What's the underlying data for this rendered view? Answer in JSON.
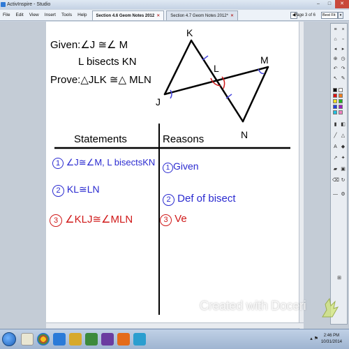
{
  "window": {
    "title": "ActivInspire - Studio",
    "min": "–",
    "max": "□",
    "close": "✕"
  },
  "menu": [
    "File",
    "Edit",
    "View",
    "Insert",
    "Tools",
    "Help"
  ],
  "tabs": [
    {
      "label": "Section 4.6 Geom Notes 2012",
      "close": "✕"
    },
    {
      "label": "Section 4.7 Geom Notes 2012*",
      "close": "✕"
    }
  ],
  "page_nav": {
    "prev": "◀",
    "page": "Page 3 of 6",
    "next": "▶",
    "zoom": "Best Fit",
    "dropdown": "▾"
  },
  "given": {
    "line1": "Given:∠J ≅∠ M",
    "line2": "L bisects KN",
    "line3": "Prove:△JLK ≅△ MLN"
  },
  "diagram_labels": {
    "K": "K",
    "L": "L",
    "M": "M",
    "J": "J",
    "N": "N"
  },
  "table": {
    "statements_header": "Statements",
    "reasons_header": "Reasons"
  },
  "proof": [
    {
      "num": "1",
      "statement": "∠J≅∠M, L bisectsKN",
      "reason_num": "1",
      "reason": "Given",
      "color": "#2a2ad0"
    },
    {
      "num": "2",
      "statement": "KL≅LN",
      "reason_num": "2",
      "reason": "Def of bisect",
      "color": "#2a2ad0"
    },
    {
      "num": "3",
      "statement": "∠KLJ≅∠MLN",
      "reason_num": "3",
      "reason": "Ve",
      "color": "#d01818"
    }
  ],
  "watermark": "Created with Doceri",
  "taskbar": {
    "time": "2:46 PM",
    "date": "10/31/2014"
  },
  "colors": {
    "ink_blue": "#2a2ad0",
    "ink_red": "#d01818",
    "diagram_mark": "#4a4adf"
  }
}
